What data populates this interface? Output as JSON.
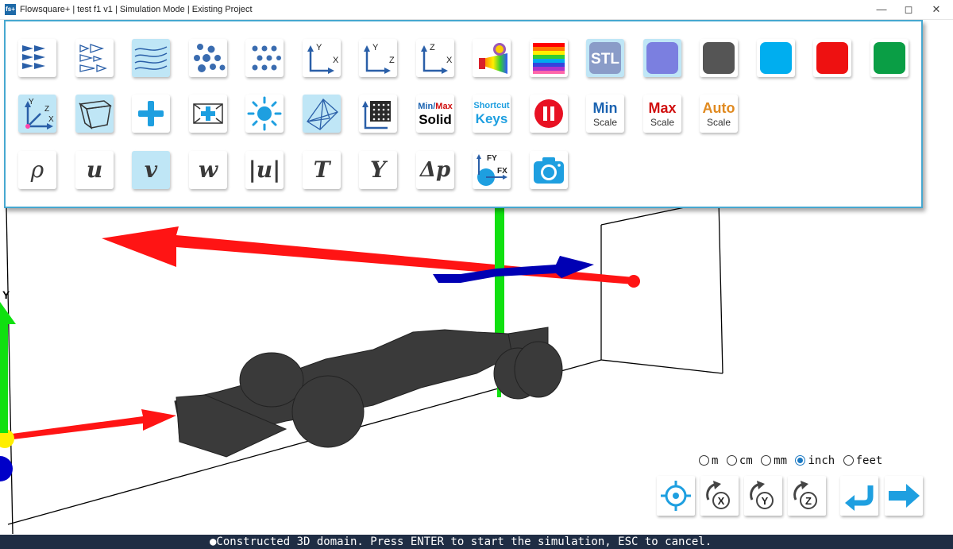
{
  "window": {
    "title": "Flowsquare+ | test f1 v1 | Simulation Mode | Existing Project",
    "app_icon_text": "fs+",
    "controls": [
      "minimize",
      "maximize",
      "close"
    ]
  },
  "toolbar": {
    "row1": [
      {
        "name": "vectors-uniform",
        "icon": "vector-arrows-filled-icon",
        "active": false
      },
      {
        "name": "vectors-scaled",
        "icon": "vector-arrows-outline-icon",
        "active": false
      },
      {
        "name": "streamlines",
        "icon": "streamlines-icon",
        "active": true
      },
      {
        "name": "particles",
        "icon": "particles-icon",
        "active": false
      },
      {
        "name": "grid-points",
        "icon": "grid-points-icon",
        "active": false
      },
      {
        "name": "plane-xy",
        "icon": "axes-xy-icon",
        "axes": [
          "Y",
          "X"
        ],
        "active": false
      },
      {
        "name": "plane-yz",
        "icon": "axes-yz-icon",
        "axes": [
          "Y",
          "Z"
        ],
        "active": false
      },
      {
        "name": "plane-zx",
        "icon": "axes-zx-icon",
        "axes": [
          "Z",
          "X"
        ],
        "active": false
      },
      {
        "name": "light-spectrum",
        "icon": "prism-icon",
        "active": false
      },
      {
        "name": "colormap",
        "icon": "rainbow-colormap-icon",
        "active": false
      },
      {
        "name": "stl",
        "icon": "stl-icon",
        "label": "STL",
        "active": true
      },
      {
        "name": "color-purple",
        "icon": "color-swatch-icon",
        "color": "#7b7fe0",
        "active": true
      },
      {
        "name": "color-gray",
        "icon": "color-swatch-icon",
        "color": "#555555",
        "active": false
      },
      {
        "name": "color-cyan",
        "icon": "color-swatch-icon",
        "color": "#00aeef",
        "active": false
      },
      {
        "name": "color-red",
        "icon": "color-swatch-icon",
        "color": "#ee1111",
        "active": false
      },
      {
        "name": "color-green",
        "icon": "color-swatch-icon",
        "color": "#0a9e45",
        "active": false
      }
    ],
    "row2": [
      {
        "name": "axes-toggle",
        "icon": "axes-3d-icon",
        "axes": [
          "Y",
          "Z",
          "X"
        ],
        "active": true
      },
      {
        "name": "domain-box",
        "icon": "domain-box-icon",
        "active": true
      },
      {
        "name": "add-object",
        "icon": "plus-icon",
        "active": false
      },
      {
        "name": "add-inlet",
        "icon": "box-plus-icon",
        "active": false
      },
      {
        "name": "lighting",
        "icon": "sun-icon",
        "active": false
      },
      {
        "name": "mesh-wireframe",
        "icon": "wireframe-icon",
        "active": true
      },
      {
        "name": "mesh-grid",
        "icon": "mesh-grid-icon",
        "active": false
      },
      {
        "name": "min-max-solid",
        "icon": "minmax-solid-icon",
        "line1_a": "Min/",
        "line1_b": "Max",
        "line2": "Solid",
        "active": false
      },
      {
        "name": "shortcut-keys",
        "icon": "shortcut-keys-icon",
        "line1": "Shortcut",
        "line2": "Keys",
        "active": false
      },
      {
        "name": "pause",
        "icon": "pause-icon",
        "active": false
      },
      {
        "name": "min-scale",
        "icon": "min-scale-icon",
        "line1": "Min",
        "line2": "Scale",
        "active": false
      },
      {
        "name": "max-scale",
        "icon": "max-scale-icon",
        "line1": "Max",
        "line2": "Scale",
        "active": false
      },
      {
        "name": "auto-scale",
        "icon": "auto-scale-icon",
        "line1": "Auto",
        "line2": "Scale",
        "active": false
      }
    ],
    "row3": [
      {
        "name": "density",
        "icon": "rho-icon",
        "label": "ρ",
        "active": false
      },
      {
        "name": "velocity-u",
        "icon": "u-icon",
        "label": "u",
        "active": false
      },
      {
        "name": "velocity-v",
        "icon": "v-icon",
        "label": "v",
        "active": true
      },
      {
        "name": "velocity-w",
        "icon": "w-icon",
        "label": "w",
        "active": false
      },
      {
        "name": "velocity-magnitude",
        "icon": "magnitude-icon",
        "label": "|u|",
        "active": false
      },
      {
        "name": "temperature",
        "icon": "t-icon",
        "label": "T",
        "active": false
      },
      {
        "name": "mass-fraction",
        "icon": "y-icon",
        "label": "Y",
        "active": false
      },
      {
        "name": "pressure-difference",
        "icon": "delta-p-icon",
        "label": "Δp",
        "active": false
      },
      {
        "name": "forces",
        "icon": "forces-icon",
        "fy": "FY",
        "fx": "FX",
        "active": false
      },
      {
        "name": "screenshot",
        "icon": "camera-icon",
        "active": false
      }
    ]
  },
  "scene": {
    "axis_label_y": "Y",
    "colors": {
      "x_axis": "#ff1414",
      "y_axis": "#10e010",
      "z_axis": "#0000b4",
      "model": "#3a3a3a"
    }
  },
  "units": {
    "options": [
      "m",
      "cm",
      "mm",
      "inch",
      "feet"
    ],
    "selected": "inch"
  },
  "view_controls": [
    {
      "name": "reset-view",
      "icon": "crosshair-icon"
    },
    {
      "name": "rotate-x",
      "icon": "rotate-x-icon",
      "label": "X"
    },
    {
      "name": "rotate-y",
      "icon": "rotate-y-icon",
      "label": "Y"
    },
    {
      "name": "rotate-z",
      "icon": "rotate-z-icon",
      "label": "Z"
    },
    {
      "name": "back",
      "icon": "return-arrow-icon"
    },
    {
      "name": "next",
      "icon": "right-arrow-icon"
    }
  ],
  "status": {
    "message": "●Constructed 3D domain. Press ENTER to start the simulation, ESC to cancel."
  }
}
